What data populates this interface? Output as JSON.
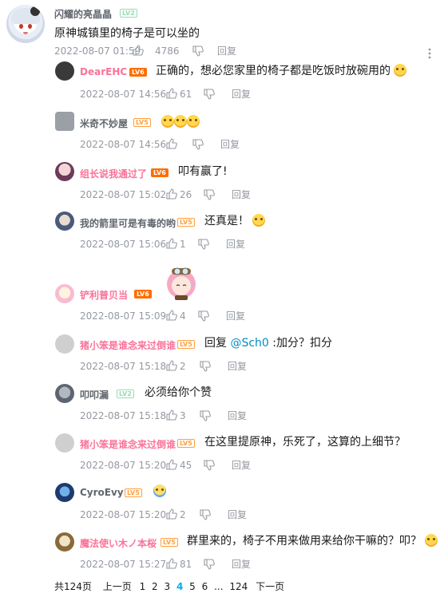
{
  "main": {
    "username": "闪耀的亮晶晶",
    "level": "LV2",
    "content": "原神城镇里的椅子是可以坐的",
    "time": "2022-08-07 01:59",
    "likes": "4786",
    "reply_label": "回复"
  },
  "replies": [
    {
      "username": "DearEHC",
      "level": "LV6",
      "content": "正确的，想必您家里的椅子都是吃饭时放碗用的",
      "time": "2022-08-07 14:56",
      "likes": "61"
    },
    {
      "username": "米奇不妙屋",
      "level": "LV5",
      "content": "",
      "time": "2022-08-07 14:56",
      "likes": ""
    },
    {
      "username": "组长说我通过了",
      "level": "LV6",
      "content": "叩有赢了!",
      "time": "2022-08-07 15:02",
      "likes": "26"
    },
    {
      "username": "我的箭里可是有毒的哟",
      "level": "LV5",
      "content": "还真是！",
      "time": "2022-08-07 15:06",
      "likes": "1"
    },
    {
      "username": "铲利普贝当",
      "level": "LV6",
      "content": "",
      "time": "2022-08-07 15:09",
      "likes": "4"
    },
    {
      "username": "猪小笨是谁念来过倒谁",
      "level": "LV5",
      "content_prefix": "回复 ",
      "mention": "@Sch0",
      "content": " :加分？扣分",
      "time": "2022-08-07 15:18",
      "likes": "2"
    },
    {
      "username": "叩叩漏",
      "level": "LV2",
      "content": "必须给你个赞",
      "time": "2022-08-07 15:18",
      "likes": "3"
    },
    {
      "username": "猪小笨是谁念来过倒谁",
      "level": "LV5",
      "content": "在这里提原神，乐死了，这算的上细节？",
      "time": "2022-08-07 15:20",
      "likes": "45"
    },
    {
      "username": "CyroEvy",
      "level": "LV5",
      "content": "",
      "time": "2022-08-07 15:20",
      "likes": "2"
    },
    {
      "username": "魔法使い木ノ本桜",
      "level": "LV5",
      "content": "群里来的，椅子不用来做用来给你干嘛的？叩？",
      "time": "2022-08-07 15:27",
      "likes": "81"
    }
  ],
  "reply_label": "回复",
  "pager": {
    "total": "共124页",
    "prev": "上一页",
    "pages": [
      "1",
      "2",
      "3",
      "4",
      "5",
      "6"
    ],
    "current": "4",
    "ellipsis": "...",
    "last": "124",
    "next": "下一页"
  },
  "colors": {
    "accent": "#00aeec",
    "pink_name": "#fb7299",
    "link": "#008ac5"
  }
}
